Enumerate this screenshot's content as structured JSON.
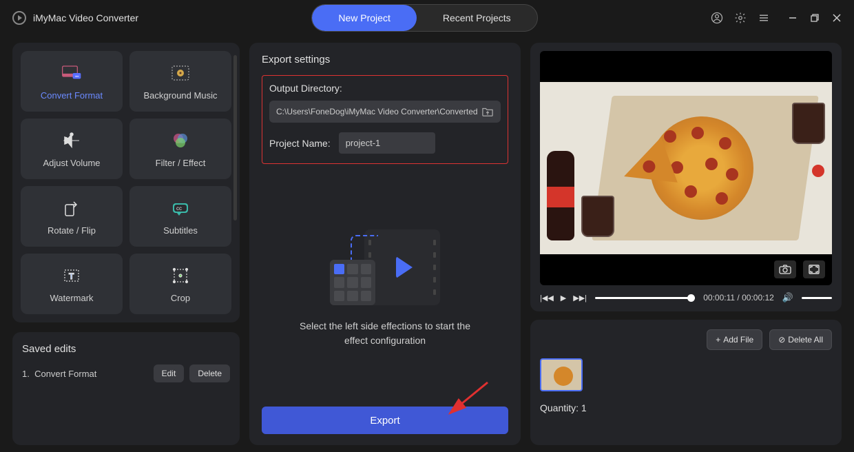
{
  "app": {
    "title": "iMyMac Video Converter"
  },
  "tabs": {
    "new": "New Project",
    "recent": "Recent Projects"
  },
  "tools": {
    "convert": "Convert Format",
    "bgmusic": "Background Music",
    "volume": "Adjust Volume",
    "filter": "Filter / Effect",
    "rotate": "Rotate / Flip",
    "subtitles": "Subtitles",
    "watermark": "Watermark",
    "crop": "Crop"
  },
  "saved": {
    "title": "Saved edits",
    "items": [
      {
        "index": "1.",
        "name": "Convert Format"
      }
    ],
    "edit_btn": "Edit",
    "delete_btn": "Delete"
  },
  "export": {
    "title": "Export settings",
    "outdir_label": "Output Directory:",
    "outdir_value": "C:\\Users\\FoneDog\\iMyMac Video Converter\\Converted",
    "pname_label": "Project Name:",
    "pname_value": "project-1",
    "hint": "Select the left side effections to start the effect configuration",
    "button": "Export"
  },
  "playback": {
    "current": "00:00:11",
    "total": "00:00:12",
    "separator": " / "
  },
  "files": {
    "add_btn": "Add File",
    "delete_btn": "Delete All",
    "quantity_label": "Quantity: ",
    "quantity_value": "1"
  }
}
